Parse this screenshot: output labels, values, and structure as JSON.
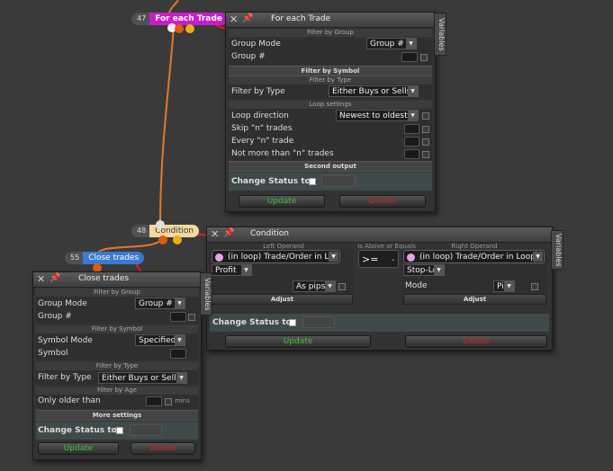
{
  "nodes": {
    "for_each": {
      "num": "47",
      "label": "For each Trade",
      "color": "#c81ec8"
    },
    "condition": {
      "num": "48",
      "label": "Condition",
      "color": "#f5d8a0"
    },
    "close_trades": {
      "num": "55",
      "label": "Close trades",
      "color": "#3a7ad0"
    }
  },
  "panel_for_each": {
    "title": "For each Trade",
    "variables_tab": "Variables",
    "filter_by_group": "Filter by Group",
    "group_mode_label": "Group Mode",
    "group_mode_value": "Group #",
    "group_num_label": "Group #",
    "filter_by_symbol": "Filter by Symbol",
    "filter_by_type": "Filter by Type",
    "filter_by_type_label": "Filter by Type",
    "filter_by_type_value": "Either Buys or Sells",
    "loop_settings": "Loop settings",
    "loop_direction_label": "Loop direction",
    "loop_direction_value": "Newest to oldest",
    "skip_label": "Skip \"n\" trades",
    "every_label": "Every \"n\" trade",
    "not_more_label": "Not more than \"n\" trades",
    "second_output": "Second output",
    "change_status_label": "Change Status to",
    "update_label": "Update",
    "delete_label": "Delete"
  },
  "panel_condition": {
    "title": "Condition",
    "variables_tab": "Variables",
    "left_operand": "Left Operand",
    "operator_label": "Is Above or Equals",
    "right_operand": "Right Operand",
    "left_value": "(in loop) Trade/Order in Loop",
    "left_sub": "Profit",
    "left_as": "As pips",
    "operator_value": ">=",
    "right_value": "(in loop) Trade/Order in Loop",
    "right_sub": "Stop-Loss",
    "mode_label": "Mode",
    "mode_value": "Pips",
    "adjust_label": "Adjust",
    "change_status_label": "Change Status to",
    "update_label": "Update",
    "delete_label": "Delete"
  },
  "panel_close": {
    "title": "Close trades",
    "variables_tab": "Variables",
    "filter_by_group": "Filter by Group",
    "group_mode_label": "Group Mode",
    "group_mode_value": "Group #",
    "group_num_label": "Group #",
    "filter_by_symbol": "Filter by Symbol",
    "symbol_mode_label": "Symbol Mode",
    "symbol_mode_value": "Specified",
    "symbol_label": "Symbol",
    "filter_by_type": "Filter by Type",
    "filter_by_type_label": "Filter by Type",
    "filter_by_type_value": "Either Buys or Sells",
    "filter_by_age": "Filter by Age",
    "only_older_label": "Only older than",
    "mins_label": "mins",
    "more_settings": "More settings",
    "change_status_label": "Change Status to",
    "update_label": "Update",
    "delete_label": "Delete"
  },
  "colors": {
    "update": "#3fc03f",
    "delete": "#d02020",
    "wire_orange": "#e07a2a",
    "wire_red": "#e02020"
  }
}
